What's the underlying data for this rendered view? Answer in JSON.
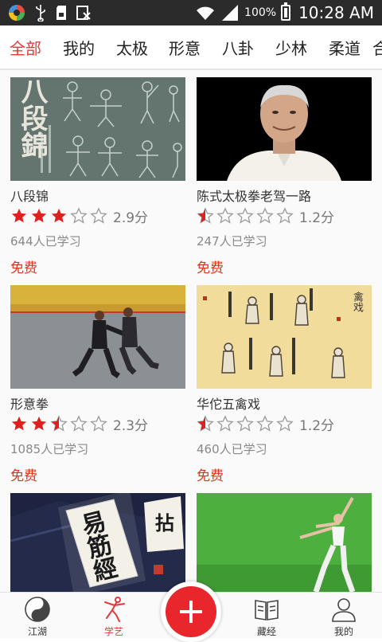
{
  "status_bar": {
    "battery_pct": "100%",
    "time": "10:28 AM"
  },
  "tabs": [
    {
      "label": "全部",
      "active": true
    },
    {
      "label": "我的"
    },
    {
      "label": "太极"
    },
    {
      "label": "形意"
    },
    {
      "label": "八卦"
    },
    {
      "label": "少林"
    },
    {
      "label": "柔道"
    },
    {
      "label": "合"
    }
  ],
  "courses": [
    {
      "title": "八段锦",
      "rating": 2.9,
      "score_text": "2.9分",
      "learners": "644人已学习",
      "price": "免费",
      "thumb_text": "八段錦"
    },
    {
      "title": "陈式太极拳老驾一路",
      "rating": 1.2,
      "score_text": "1.2分",
      "learners": "247人已学习",
      "price": "免费"
    },
    {
      "title": "形意拳",
      "rating": 2.3,
      "score_text": "2.3分",
      "learners": "1085人已学习",
      "price": "免费"
    },
    {
      "title": "华佗五禽戏",
      "rating": 1.2,
      "score_text": "1.2分",
      "learners": "460人已学习",
      "price": "免费",
      "thumb_text": "禽戏"
    },
    {
      "title": "",
      "thumb_text": "易筋經",
      "thumb_text2": "拈"
    },
    {
      "title": ""
    }
  ],
  "nav": [
    {
      "label": "江湖",
      "icon": "yin-yang-icon"
    },
    {
      "label": "学艺",
      "icon": "martial-arts-icon",
      "active": true
    },
    {
      "label": "藏经",
      "icon": "book-icon"
    },
    {
      "label": "我的",
      "icon": "user-icon"
    }
  ],
  "colors": {
    "accent": "#e23b3b",
    "fab": "#e8262c",
    "star": "#e02020"
  }
}
